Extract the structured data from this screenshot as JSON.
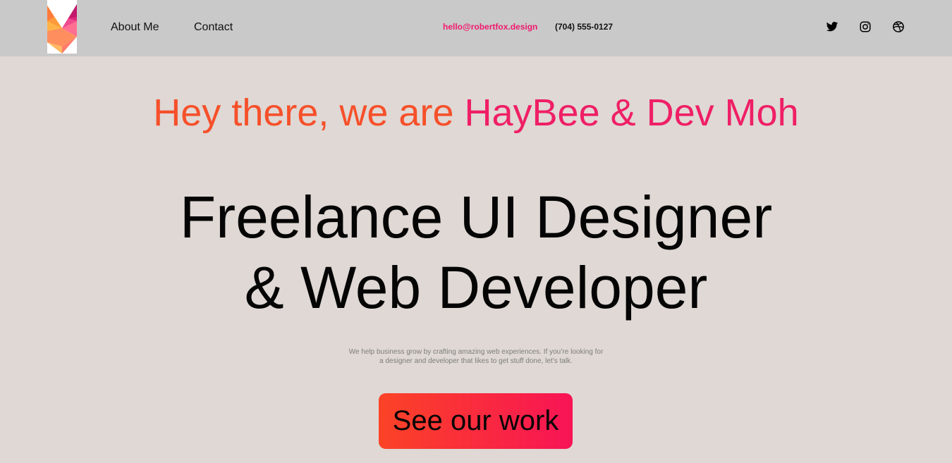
{
  "header": {
    "nav": {
      "about_label": "About Me",
      "contact_label": "Contact"
    },
    "contact": {
      "email": "hello@robertfox.design",
      "phone": "(704) 555-0127"
    },
    "social_icons": [
      "twitter-icon",
      "instagram-icon",
      "dribbble-icon"
    ]
  },
  "hero": {
    "intro_part1": "Hey there, we are ",
    "intro_part2": "HayBee & Dev Moh",
    "headline_line1": "Freelance UI Designer",
    "headline_line2": "& Web Developer",
    "description_line1": "We help business grow by crafting amazing web experiences. If you’re looking for",
    "description_line2": "a designer and developer that likes to get stuff done, let’s talk.",
    "cta_label": "See our work"
  },
  "colors": {
    "header_bg": "#c9c9c9",
    "page_bg": "#dfd8d4",
    "accent_orange": "#f6502a",
    "accent_pink": "#ef1f66",
    "email_pink": "#f0196e"
  }
}
